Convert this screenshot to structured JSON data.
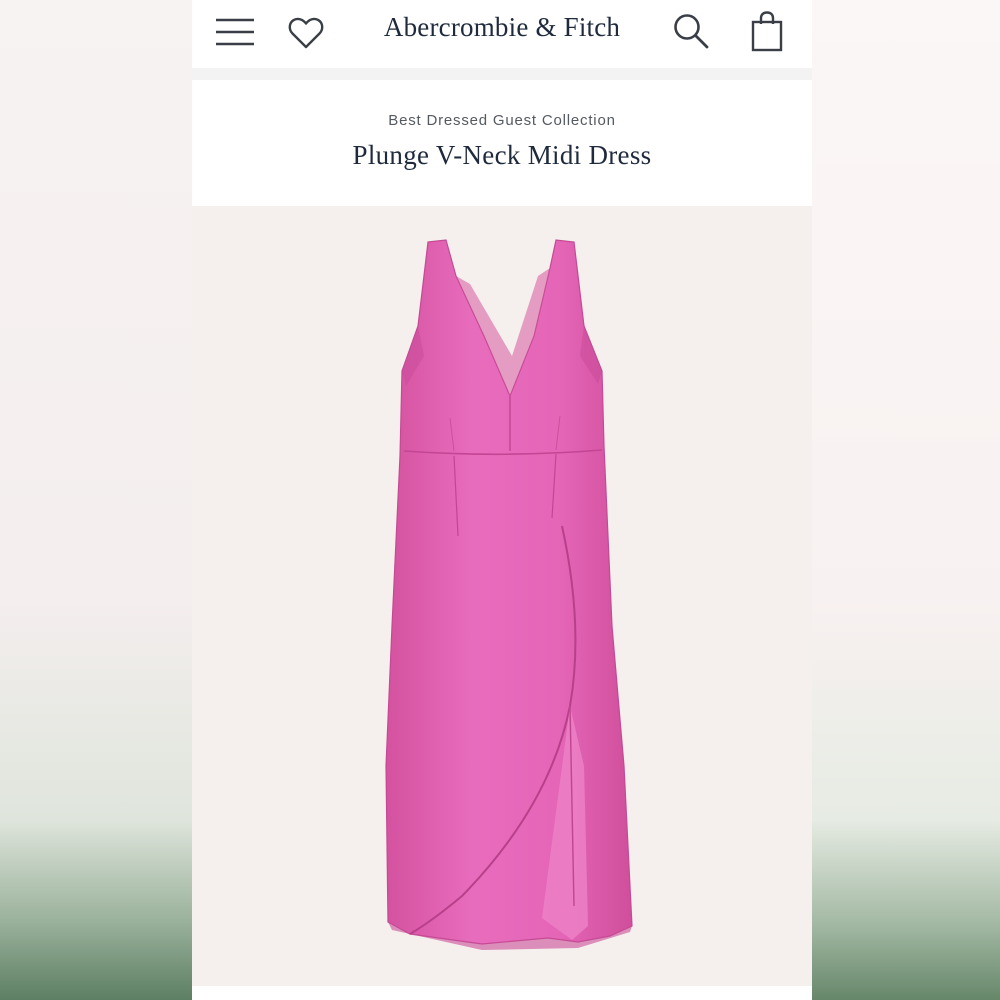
{
  "header": {
    "brand": "Abercrombie & Fitch",
    "icons": [
      "menu-icon",
      "heart-icon",
      "search-icon",
      "bag-icon"
    ]
  },
  "product": {
    "collection": "Best Dressed Guest Collection",
    "name": "Plunge V-Neck Midi Dress",
    "image_subject": "pink sleeveless plunge v-neck midi dress with front slit"
  },
  "colors": {
    "brand_text": "#1f2a3d",
    "dress": "#e367b8",
    "image_background": "#f5efed"
  }
}
